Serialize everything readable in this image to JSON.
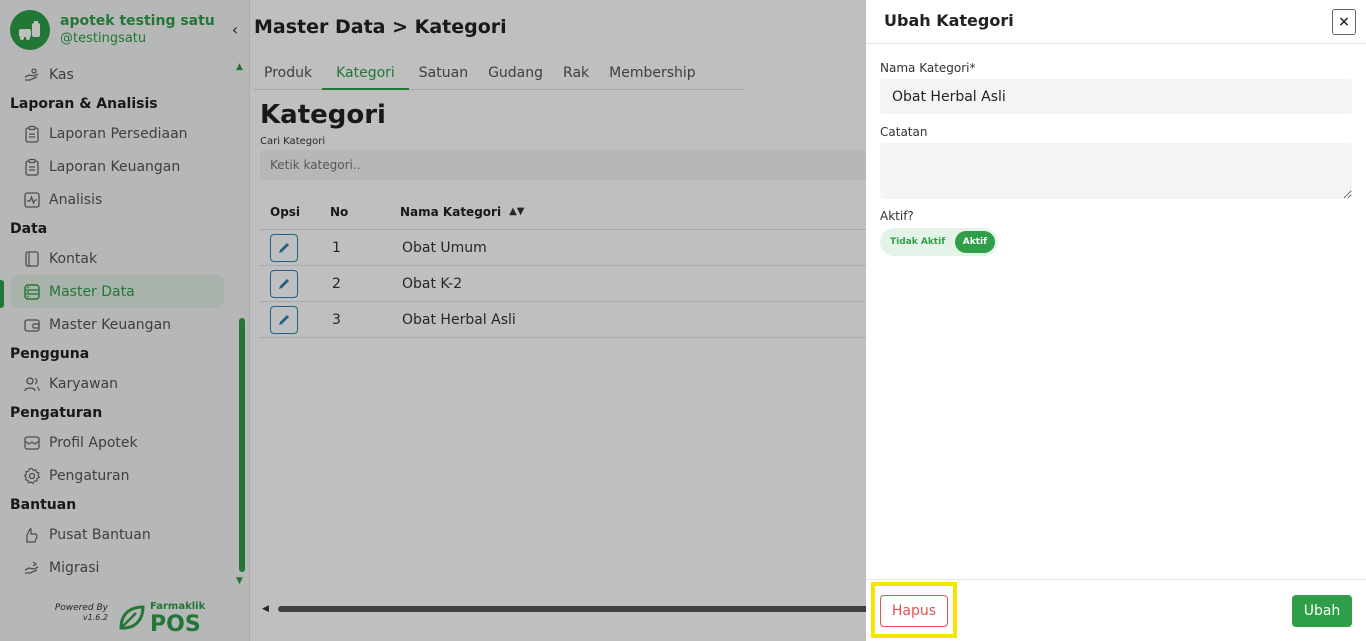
{
  "brand": {
    "name": "apotek testing satu",
    "handle": "@testingsatu"
  },
  "sidebar": {
    "top_item": "Kas",
    "sections": [
      {
        "title": "Laporan & Analisis",
        "items": [
          "Laporan Persediaan",
          "Laporan Keuangan",
          "Analisis"
        ]
      },
      {
        "title": "Data",
        "items": [
          "Kontak",
          "Master Data",
          "Master Keuangan"
        ]
      },
      {
        "title": "Pengguna",
        "items": [
          "Karyawan"
        ]
      },
      {
        "title": "Pengaturan",
        "items": [
          "Profil Apotek",
          "Pengaturan"
        ]
      },
      {
        "title": "Bantuan",
        "items": [
          "Pusat Bantuan",
          "Migrasi"
        ]
      }
    ],
    "active_item": "Master Data",
    "powered_by": "Powered By",
    "version": "v1.6.2",
    "product_small": "Farmaklik",
    "product_big": "POS"
  },
  "main": {
    "breadcrumb": "Master Data > Kategori",
    "tabs": [
      "Produk",
      "Kategori",
      "Satuan",
      "Gudang",
      "Rak",
      "Membership"
    ],
    "active_tab": "Kategori",
    "section_title": "Kategori",
    "search_label": "Cari Kategori",
    "search_placeholder": "Ketik kategori..",
    "table": {
      "headers": {
        "opsi": "Opsi",
        "no": "No",
        "name": "Nama Kategori"
      },
      "rows": [
        {
          "no": "1",
          "name": "Obat Umum"
        },
        {
          "no": "2",
          "name": "Obat K-2"
        },
        {
          "no": "3",
          "name": "Obat Herbal Asli"
        }
      ]
    }
  },
  "drawer": {
    "title": "Ubah Kategori",
    "name_label": "Nama Kategori*",
    "name_value": "Obat Herbal Asli",
    "note_label": "Catatan",
    "note_value": "",
    "active_label": "Aktif?",
    "toggle_off": "Tidak Aktif",
    "toggle_on": "Aktif",
    "delete_label": "Hapus",
    "submit_label": "Ubah"
  },
  "colors": {
    "brand_green": "#2e9e48",
    "danger": "#e05454",
    "highlight": "#f5e600"
  }
}
